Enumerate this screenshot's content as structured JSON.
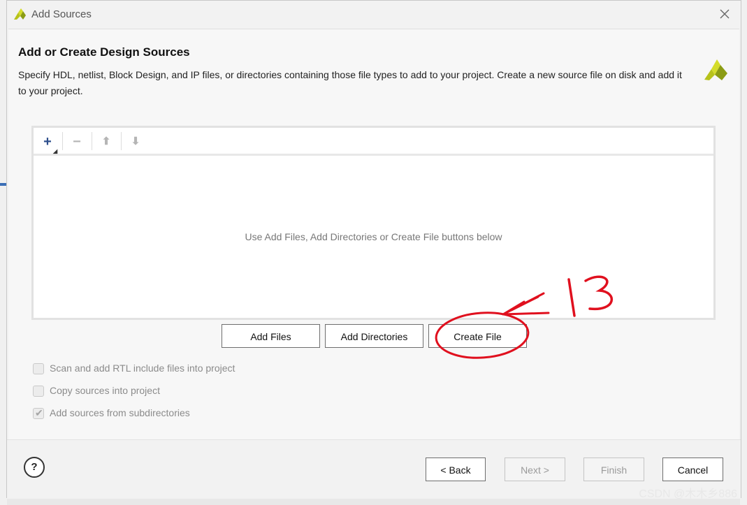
{
  "dialog": {
    "title": "Add Sources",
    "close_icon": "close-icon",
    "heading": "Add or Create Design Sources",
    "description": "Specify HDL, netlist, Block Design, and IP files, or directories containing those file types to add to your project. Create a new source file on disk and add it to your project."
  },
  "toolbar": {
    "add": "+",
    "remove": "−",
    "move_up": "⬆",
    "move_down": "⬇"
  },
  "file_list": {
    "empty_hint": "Use Add Files, Add Directories or Create File buttons below"
  },
  "actions": {
    "add_files": "Add Files",
    "add_directories": "Add Directories",
    "create_file": "Create File"
  },
  "options": [
    {
      "label": "Scan and add RTL include files into project",
      "checked": false
    },
    {
      "label": "Copy sources into project",
      "checked": false
    },
    {
      "label": "Add sources from subdirectories",
      "checked": true
    }
  ],
  "footer": {
    "help": "?",
    "back": "< Back",
    "next": "Next >",
    "finish": "Finish",
    "cancel": "Cancel"
  },
  "annotation": {
    "number": "13",
    "color": "#e0101e"
  },
  "watermark": "CSDN @木木乡886",
  "colors": {
    "brand_yellow": "#b7c21a",
    "brand_green": "#7a8c12",
    "annotation_red": "#e0101e"
  }
}
